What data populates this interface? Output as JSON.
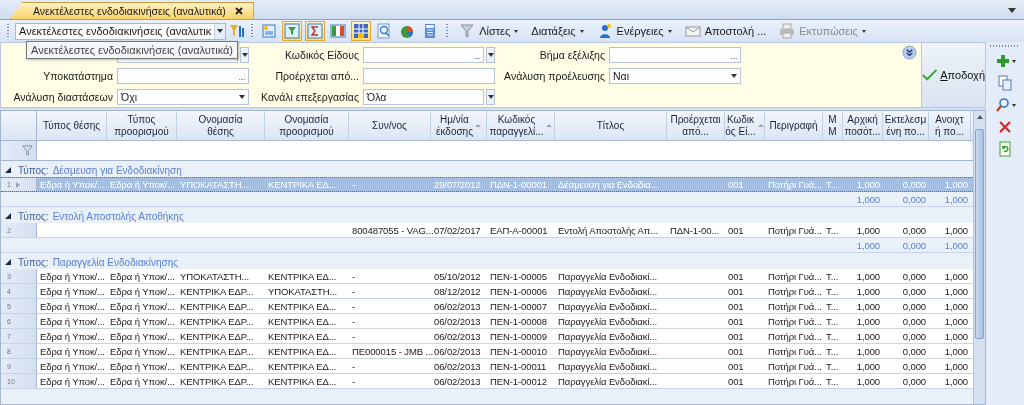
{
  "tab": {
    "title": "Ανεκτέλεστες ενδοδιακινήσεις (αναλυτικά)"
  },
  "toolbar": {
    "view_combo": "Ανεκτέλεστες ενδοδιακινήσεις (αναλυτικ",
    "toggles": [
      {
        "kind": "new",
        "on": false
      },
      {
        "kind": "filter",
        "on": true
      },
      {
        "kind": "sum",
        "on": true
      },
      {
        "kind": "columns",
        "on": false
      },
      {
        "kind": "grid",
        "on": true
      },
      {
        "kind": "zoom",
        "on": false
      },
      {
        "kind": "chart",
        "on": false
      },
      {
        "kind": "calc",
        "on": false
      }
    ],
    "menus": [
      {
        "label": "Λίστες",
        "caret": true,
        "disabled": false
      },
      {
        "label": "Διατάξεις",
        "caret": true,
        "disabled": false
      },
      {
        "label": "Ενέργειες",
        "caret": true,
        "disabled": false
      },
      {
        "label": "Αποστολή ...",
        "caret": false,
        "disabled": false
      },
      {
        "label": "Εκτυπώσεις",
        "caret": true,
        "disabled": true
      }
    ]
  },
  "tooltip": "Ανεκτέλεστες ενδοδιακινήσεις (αναλυτικά)",
  "filters": [
    [
      {
        "kind": "dropdown-button"
      },
      {
        "label": "Υποκατάστημα",
        "kind": "lookup"
      },
      {
        "label": "Ανάλυση διαστάσεων",
        "kind": "dropdown",
        "value": "Όχι"
      }
    ],
    [
      {
        "label": "Κωδικός Είδους",
        "kind": "lookup-button"
      },
      {
        "label": "Προέρχεται από...",
        "kind": "text"
      },
      {
        "label": "Κανάλι επεξεργασίας",
        "kind": "dropdown-button",
        "value": "Όλα"
      }
    ],
    [
      {
        "label": "Βήμα εξέλιξης",
        "kind": "lookup"
      },
      {
        "label": "Ανάλυση προέλευσης",
        "kind": "dropdown",
        "value": "Ναι"
      }
    ]
  ],
  "accept_button": "Αποδοχή",
  "table": {
    "columns": [
      {
        "label": "Τύπος θέσης",
        "sort": false
      },
      {
        "label": "Τύπος\nπροορισμού",
        "sort": false
      },
      {
        "label": "Ονομασία\nθέσης",
        "sort": false
      },
      {
        "label": "Ονομασία\nπροορισμού",
        "sort": false
      },
      {
        "label": "Συν/νος",
        "sort": false
      },
      {
        "label": "Ημ/νία\nέκδοσης",
        "sort": true
      },
      {
        "label": "Κωδικός\nπαραγγελί...",
        "sort": true
      },
      {
        "label": "Τίτλος",
        "sort": false
      },
      {
        "label": "Προέρχεται\nαπό...",
        "sort": false
      },
      {
        "label": "Κωδικ\nός Εί...",
        "sort": true
      },
      {
        "label": "Περιγραφή",
        "sort": false
      },
      {
        "label": "Μ\nΜ",
        "sort": false
      },
      {
        "label": "Αρχική\nποσότ...",
        "sort": false
      },
      {
        "label": "Εκτελεσμ\nένη πο...",
        "sort": false
      },
      {
        "label": "Ανοιχτ\nή πο...",
        "sort": false
      }
    ],
    "groups": [
      {
        "prefix": "Τύπος:",
        "name": "Δέσμευση για Ενδοδιακίνηση",
        "expanded": true,
        "rows": [
          {
            "number": "1",
            "selected": true,
            "cells": [
              "Εδρα ή Υποκ/...",
              "Εδρα ή Υποκ/...",
              "ΥΠΟΚΑΤΑΣΤΗ...",
              "ΚΕΝΤΡΙΚΑ ΕΔ...",
              "-",
              "29/07/2012",
              "ΠΔΝ-1-00001",
              "Δέσμευση για Ενδοδια...",
              null,
              "001",
              "Ποτήρι Γυά...",
              "Τ...",
              "1,000",
              "0,000",
              "1,000"
            ]
          }
        ],
        "totals": [
          "1,000",
          "0,000",
          "1,000"
        ]
      },
      {
        "prefix": "Τύπος:",
        "name": "Εντολή Αποστολής Αποθήκης",
        "expanded": true,
        "rows": [
          {
            "number": "2",
            "selected": false,
            "cells": [
              null,
              null,
              null,
              null,
              "800487055 - VAG...",
              "07/02/2017",
              "ΕΑΠ-Α-00001",
              "Εντολή Αποστολής Απ...",
              "ΠΔΝ-1-00...",
              "001",
              "Ποτήρι Γυά...",
              "Τ...",
              "1,000",
              "0,000",
              "1,000"
            ]
          }
        ],
        "totals": [
          "1,000",
          "0,000",
          "1,000"
        ]
      },
      {
        "prefix": "Τύπος:",
        "name": "Παραγγελία Ενδοδιακίνησης",
        "expanded": true,
        "rows": [
          {
            "number": "3",
            "selected": false,
            "cells": [
              "Εδρα ή Υποκ/...",
              "Εδρα ή Υποκ/...",
              "ΥΠΟΚΑΤΑΣΤΗ...",
              "ΚΕΝΤΡΙΚΑ ΕΔ...",
              "-",
              "05/10/2012",
              "ΠΕΝ-1-00005",
              "Παραγγελία Ενδοδιακί...",
              null,
              "001",
              "Ποτήρι Γυά...",
              "Τ...",
              "1,000",
              "0,000",
              "1,000"
            ]
          },
          {
            "number": "4",
            "selected": false,
            "cells": [
              "Εδρα ή Υποκ/...",
              "Εδρα ή Υποκ/...",
              "ΚΕΝΤΡΙΚΑ ΕΔΡ...",
              "ΥΠΟΚΑΤΑΣΤΗ...",
              "-",
              "08/12/2012",
              "ΠΕΝ-1-00006",
              "Παραγγελία Ενδοδιακί...",
              null,
              "001",
              "Ποτήρι Γυά...",
              "Τ...",
              "1,000",
              "0,000",
              "1,000"
            ]
          },
          {
            "number": "5",
            "selected": false,
            "cells": [
              "Εδρα ή Υποκ/...",
              "Εδρα ή Υποκ/...",
              "ΚΕΝΤΡΙΚΑ ΕΔΡ...",
              "ΚΕΝΤΡΙΚΑ ΕΔ...",
              "-",
              "06/02/2013",
              "ΠΕΝ-1-00007",
              "Παραγγελία Ενδοδιακί...",
              null,
              "001",
              "Ποτήρι Γυά...",
              "Τ...",
              "1,000",
              "0,000",
              "1,000"
            ]
          },
          {
            "number": "6",
            "selected": false,
            "cells": [
              "Εδρα ή Υποκ/...",
              "Εδρα ή Υποκ/...",
              "ΚΕΝΤΡΙΚΑ ΕΔΡ...",
              "ΚΕΝΤΡΙΚΑ ΕΔ...",
              "-",
              "06/02/2013",
              "ΠΕΝ-1-00008",
              "Παραγγελία Ενδοδιακί...",
              null,
              "001",
              "Ποτήρι Γυά...",
              "Τ...",
              "1,000",
              "0,000",
              "1,000"
            ]
          },
          {
            "number": "7",
            "selected": false,
            "cells": [
              "Εδρα ή Υποκ/...",
              "Εδρα ή Υποκ/...",
              "ΚΕΝΤΡΙΚΑ ΕΔΡ...",
              "ΚΕΝΤΡΙΚΑ ΕΔ...",
              "-",
              "06/02/2013",
              "ΠΕΝ-1-00009",
              "Παραγγελία Ενδοδιακί...",
              null,
              "001",
              "Ποτήρι Γυά...",
              "Τ...",
              "1,000",
              "0,000",
              "1,000"
            ]
          },
          {
            "number": "8",
            "selected": false,
            "cells": [
              "Εδρα ή Υποκ/...",
              "Εδρα ή Υποκ/...",
              "ΚΕΝΤΡΙΚΑ ΕΔΡ...",
              "ΚΕΝΤΡΙΚΑ ΕΔ...",
              "ΠΕ000015 - JMB ...",
              "06/02/2013",
              "ΠΕΝ-1-00010",
              "Παραγγελία Ενδοδιακί...",
              null,
              "001",
              "Ποτήρι Γυά...",
              "Τ...",
              "1,000",
              "0,000",
              "1,000"
            ]
          },
          {
            "number": "9",
            "selected": false,
            "cells": [
              "Εδρα ή Υποκ/...",
              "Εδρα ή Υποκ/...",
              "ΚΕΝΤΡΙΚΑ ΕΔΡ...",
              "ΚΕΝΤΡΙΚΑ ΕΔ...",
              "-",
              "06/02/2013",
              "ΠΕΝ-1-00011",
              "Παραγγελία Ενδοδιακί...",
              null,
              "001",
              "Ποτήρι Γυά...",
              "Τ...",
              "1,000",
              "0,000",
              "1,000"
            ]
          },
          {
            "number": "10",
            "selected": false,
            "cells": [
              "Εδρα ή Υποκ/...",
              "Εδρα ή Υποκ/...",
              "ΚΕΝΤΡΙΚΑ ΕΔΡ...",
              "ΚΕΝΤΡΙΚΑ ΕΔ...",
              "-",
              "06/02/2013",
              "ΠΕΝ-1-00012",
              "Παραγγελία Ενδοδιακί...",
              null,
              "001",
              "Ποτήρι Γυά...",
              "Τ...",
              "1,000",
              "0,000",
              "1,000"
            ]
          }
        ]
      }
    ]
  }
}
